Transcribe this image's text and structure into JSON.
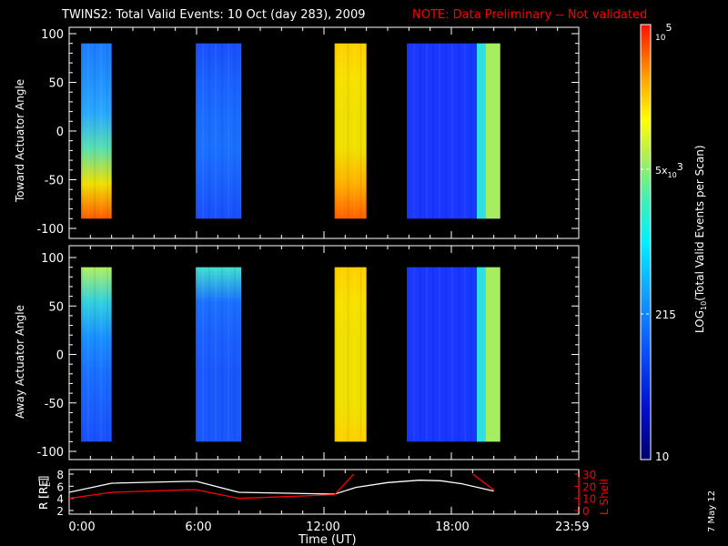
{
  "chart_data": {
    "type": "heatmap",
    "title": "TWINS2: Total Valid Events: 10 Oct (day 283), 2009",
    "note": "NOTE: Data Preliminary -- Not validated",
    "date_stamp": "7 May 12",
    "xlabel": "Time (UT)",
    "x_ticks": [
      "0:00",
      "6:00",
      "12:00",
      "18:00",
      "23:59"
    ],
    "xlim_hours": [
      0,
      24
    ],
    "colorbar": {
      "label": "LOG10(Total Valid Events per Scan)",
      "label_main": "LOG",
      "label_sub": "10",
      "label_rest": "(Total Valid Events per Scan)",
      "ticks": [
        "10",
        "215",
        "5x10^3",
        "10^5"
      ],
      "tick_5k_main": "5x",
      "tick_5k_base": "10",
      "tick_5k_exp": "3",
      "tick_max_base": "10",
      "tick_max_exp": "5",
      "range": [
        10,
        100000
      ]
    },
    "panels": [
      {
        "name": "toward",
        "ylabel": "Toward Actuator Angle",
        "ylim": [
          -100,
          100
        ],
        "y_ticks": [
          "100",
          "50",
          "0",
          "-50",
          "-100"
        ],
        "blocks": [
          {
            "t0": 0.56,
            "t1": 2.0,
            "a0": -90,
            "a1": 90,
            "colors_top_to_bottom": [
              "#1e7cff",
              "#2090ff",
              "#2aa8ff",
              "#58e0b0",
              "#f0e000",
              "#ff5a00"
            ]
          },
          {
            "t0": 5.96,
            "t1": 8.1,
            "a0": -90,
            "a1": 90,
            "colors_top_to_bottom": [
              "#1a50ff",
              "#1a60ff",
              "#1a6cff",
              "#1a70ff",
              "#1a60ff",
              "#1a50ff"
            ]
          },
          {
            "t0": 12.5,
            "t1": 14.0,
            "a0": -90,
            "a1": 90,
            "colors_top_to_bottom": [
              "#ffd000",
              "#f8e000",
              "#f0e000",
              "#f0e000",
              "#ffb000",
              "#ff6000"
            ]
          },
          {
            "t0": 15.9,
            "t1": 20.3,
            "a0": -90,
            "a1": 90,
            "colors_top_to_bottom": [
              "#1838ff",
              "#1838ff",
              "#1838ff",
              "#1838ff",
              "#1838ff",
              "#1838ff"
            ]
          }
        ]
      },
      {
        "name": "away",
        "ylabel": "Away Actuator Angle",
        "ylim": [
          -100,
          100
        ],
        "y_ticks": [
          "100",
          "50",
          "0",
          "-50",
          "-100"
        ],
        "blocks": [
          {
            "t0": 0.56,
            "t1": 2.0,
            "a0": -90,
            "a1": 90,
            "colors_top_to_bottom": [
              "#b0f060",
              "#30d0e0",
              "#1a90ff",
              "#1a70ff",
              "#1a60ff",
              "#1a50ff"
            ]
          },
          {
            "t0": 5.96,
            "t1": 8.1,
            "a0": -90,
            "a1": 90,
            "colors_top_to_bottom": [
              "#40e0d0",
              "#1a70ff",
              "#1a60ff",
              "#1a58ff",
              "#1a58ff",
              "#1a58ff"
            ]
          },
          {
            "t0": 12.5,
            "t1": 14.0,
            "a0": -90,
            "a1": 90,
            "colors_top_to_bottom": [
              "#ffd000",
              "#f8e000",
              "#f0e000",
              "#f0e000",
              "#f0e000",
              "#ffd000"
            ]
          },
          {
            "t0": 15.9,
            "t1": 20.3,
            "a0": -90,
            "a1": 90,
            "colors_top_to_bottom": [
              "#1838ff",
              "#1838ff",
              "#1838ff",
              "#1838ff",
              "#1838ff",
              "#1838ff"
            ]
          }
        ]
      }
    ],
    "orbit": {
      "ylabel_left": "R [RE]",
      "ylabel_left_main": "R [R",
      "ylabel_left_sub": "E",
      "ylabel_left_end": "]",
      "ylabel_right": "L Shell",
      "y_ticks_left": [
        "2",
        "4",
        "6",
        "8"
      ],
      "y_ticks_right": [
        "0",
        "10",
        "20",
        "30"
      ],
      "ylim_left": [
        2,
        8
      ],
      "ylim_right": [
        0,
        30
      ],
      "r_color": "#ffffff",
      "l_color": "#ff0000",
      "r_series": {
        "name": "R",
        "x": [
          0,
          2,
          5.5,
          6,
          8,
          12.5,
          13.5,
          15,
          16.5,
          17.5,
          18.5,
          20
        ],
        "y": [
          5,
          6.5,
          6.8,
          6.8,
          5,
          4.7,
          5.8,
          6.6,
          7,
          6.9,
          6.4,
          5.2
        ]
      },
      "l_series": [
        {
          "name": "L Shell",
          "x": [
            0,
            2,
            5.5,
            6,
            8,
            12.5,
            13.4
          ],
          "y": [
            10,
            15,
            17,
            17,
            10,
            13,
            30
          ]
        },
        {
          "name": "L Shell",
          "x": [
            19.0,
            20.0
          ],
          "y": [
            30,
            17
          ]
        }
      ]
    }
  }
}
